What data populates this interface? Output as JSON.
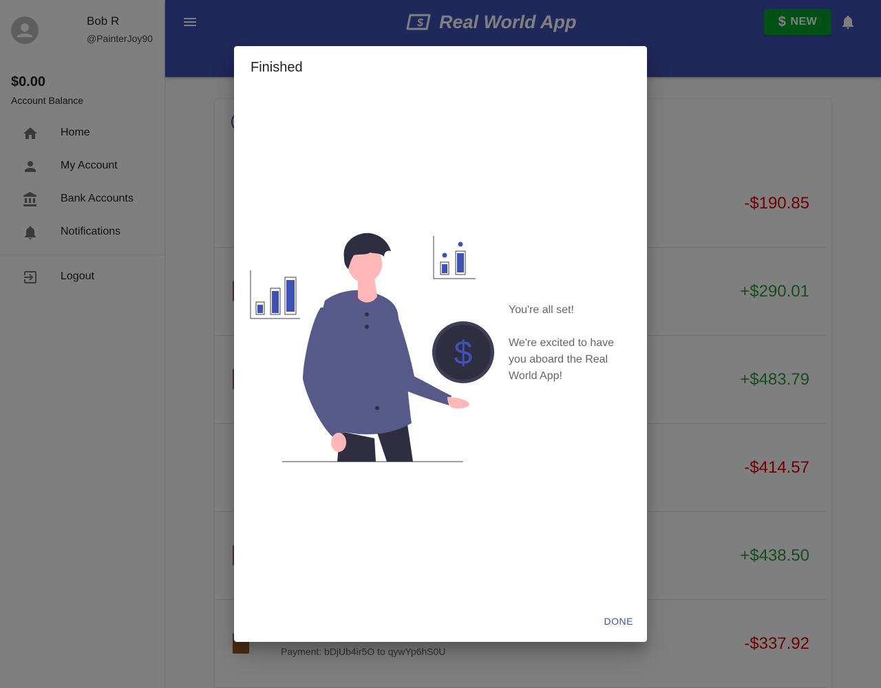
{
  "app": {
    "title": "Real World App",
    "new_button_label": "NEW",
    "new_button_symbol": "$",
    "accent_color": "#3f51b5",
    "new_button_color": "#00a32a"
  },
  "sidebar": {
    "user_name": "Bob R",
    "user_handle": "@PainterJoy90",
    "balance": "$0.00",
    "balance_label": "Account Balance",
    "items": [
      {
        "label": "Home",
        "icon": "home-icon"
      },
      {
        "label": "My Account",
        "icon": "person-icon"
      },
      {
        "label": "Bank Accounts",
        "icon": "bank-icon"
      },
      {
        "label": "Notifications",
        "icon": "bell-icon"
      },
      {
        "label": "Logout",
        "icon": "logout-icon"
      }
    ]
  },
  "transactions": [
    {
      "amount": "-$190.85",
      "sign": "negative"
    },
    {
      "amount": "+$290.01",
      "sign": "positive"
    },
    {
      "amount": "+$483.79",
      "sign": "positive"
    },
    {
      "amount": "-$414.57",
      "sign": "negative"
    },
    {
      "amount": "+$438.50",
      "sign": "positive"
    },
    {
      "amount": "-$337.92",
      "sign": "negative",
      "description": "Payment: bDjUb4ir5O to qywYp6hS0U"
    }
  ],
  "dialog": {
    "title": "Finished",
    "message_line1": "You're all set!",
    "message_line2": "We're excited to have you aboard the Real World App!",
    "done_label": "DONE"
  }
}
